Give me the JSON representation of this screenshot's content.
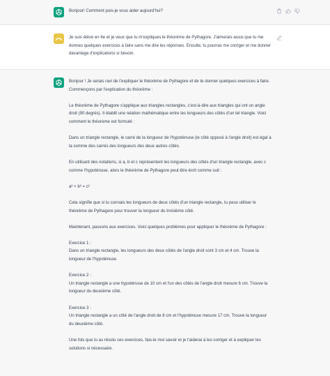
{
  "messages": [
    {
      "role": "assistant",
      "paragraphs": [
        "Bonjour! Comment puis-je vous aider aujourd'hui?"
      ]
    },
    {
      "role": "user",
      "paragraphs": [
        "Je suis élève en 6e et je veux que tu m'expliques le théorème de Pythagore. J'aimerais aussi que tu me donnes quelques exercices à faire sans me dire les réponses. Ensuite, tu pourras me corriger et me donner davantage d'explications si besoin."
      ]
    },
    {
      "role": "assistant",
      "paragraphs": [
        "Bonjour ! Je serais ravi de t'expliquer le théorème de Pythagore et de te donner quelques exercices à faire. Commençons par l'explication du théorème :",
        "Le théorème de Pythagore s'applique aux triangles rectangles, c'est-à-dire aux triangles qui ont un angle droit (90 degrés). Il établit une relation mathématique entre les longueurs des côtés d'un tel triangle. Voici comment le théorème est formulé :",
        "Dans un triangle rectangle, le carré de la longueur de l'hypoténuse (le côté opposé à l'angle droit) est égal à la somme des carrés des longueurs des deux autres côtés.",
        "En utilisant des notations, si a, b et c représentent les longueurs des côtés d'un triangle rectangle, avec c comme l'hypoténuse, alors le théorème de Pythagore peut être écrit comme suit :",
        "a² + b² = c²",
        "Cela signifie que si tu connais les longueurs de deux côtés d'un triangle rectangle, tu peux utiliser le théorème de Pythagore pour trouver la longueur du troisième côté.",
        "Maintenant, passons aux exercices. Voici quelques problèmes pour appliquer le théorème de Pythagore :",
        "Exercice 1 :\nDans un triangle rectangle, les longueurs des deux côtés de l'angle droit sont 3 cm et 4 cm. Trouve la longueur de l'hypoténuse.",
        "Exercice 2 :\nUn triangle rectangle a une hypoténuse de 10 cm et l'un des côtés de l'angle droit mesure 6 cm. Trouve la longueur du deuxième côté.",
        "Exercice 3 :\nUn triangle rectangle a un côté de l'angle droit de 8 cm et l'hypoténuse mesure 17 cm. Trouve la longueur du deuxième côté.",
        "Une fois que tu as résolu ces exercices, fais-le moi savoir et je t'aiderai à les corriger et à expliquer les solutions si nécessaire."
      ]
    }
  ],
  "icons": {
    "assistant_avatar": "openai-logo-icon",
    "user_avatar": "user-avatar-icon",
    "copy": "clipboard-icon",
    "like": "thumbs-up-icon",
    "dislike": "thumbs-down-icon",
    "edit": "edit-icon"
  },
  "colors": {
    "assistant_bg": "#f7f7f8",
    "user_bg": "#ffffff",
    "assistant_avatar": "#10a37f",
    "user_avatar": "#e8c547",
    "text": "#374151",
    "icon": "#9ca3af"
  }
}
